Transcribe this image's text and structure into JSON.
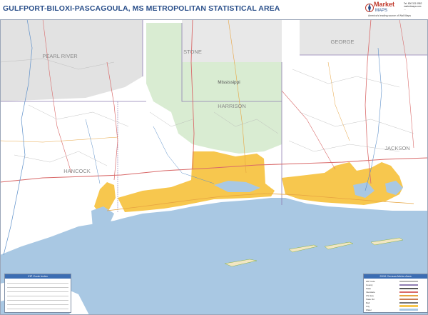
{
  "title": "GULFPORT-BILOXI-PASCAGOULA, MS METROPOLITAN STATISTICAL AREA",
  "logo": {
    "name": "Market",
    "sub": "MAPS",
    "tagline": "America's leading source of Wall Maps",
    "contact": "Tel: 800 321 0982\nmarketmaps.com\n..."
  },
  "map_labels": {
    "pearl_river": "PEARL RIVER",
    "stone": "STONE",
    "george": "GEORGE",
    "mississippi": "Mississippi",
    "harrison": "HARRISON",
    "hancock": "HANCOCK",
    "jackson": "JACKSON"
  },
  "legend_left": {
    "title": "ZIP Code Index"
  },
  "legend_right": {
    "title": "2010 Census Metro Area",
    "rows": [
      "ZIP Code",
      "County",
      "State",
      "Interstate",
      "US Hwy",
      "State Rd",
      "Rail",
      "City",
      "Water"
    ]
  },
  "colors": {
    "water": "#a9c8e3",
    "land": "#ffffff",
    "forest": "#d9ecd2",
    "outside": "#e2e2e2",
    "urban": "#f7c74e",
    "road_red": "#d96a6a",
    "road_orange": "#e7a441",
    "county_line": "#8e7db3",
    "title_blue": "#2a4f8a"
  },
  "icons": [
    "compass-icon"
  ]
}
